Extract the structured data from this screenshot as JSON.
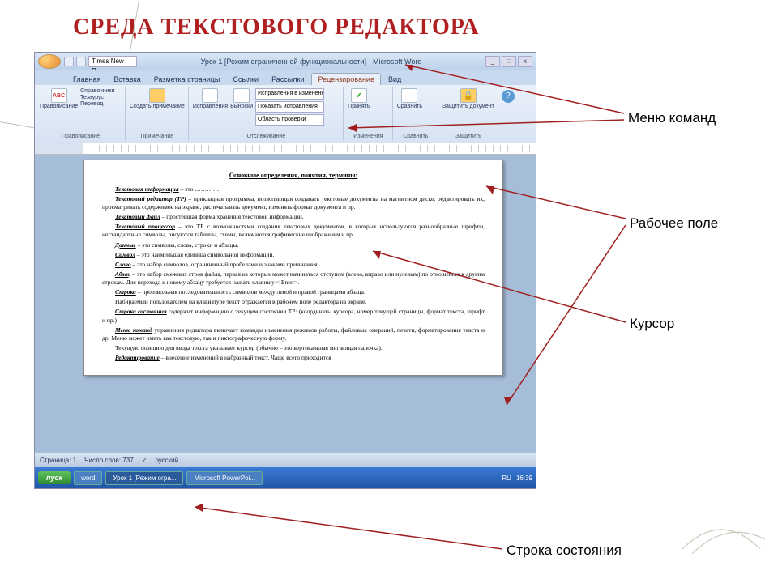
{
  "slide": {
    "title": "СРЕДА ТЕКСТОВОГО РЕДАКТОРА"
  },
  "callouts": {
    "menu": "Меню команд",
    "workspace": "Рабочее поле",
    "cursor": "Курсор",
    "statusbar": "Строка состояния"
  },
  "word": {
    "title_bar": "Урок 1 [Режим ограниченной функциональности] - Microsoft Word",
    "font_box": "Times New R…",
    "tabs": [
      "Главная",
      "Вставка",
      "Разметка страницы",
      "Ссылки",
      "Рассылки",
      "Рецензирование",
      "Вид"
    ],
    "active_tab_index": 5,
    "ribbon": {
      "g1_label": "Правописание",
      "g1_btn1": "Правописание",
      "g1_btn2": "Справочники",
      "g1_btn3": "Тезаурус",
      "g1_btn4": "Перевод",
      "g2_label": "Примечание",
      "g2_btn": "Создать примечание",
      "g3_label": "Отслеживание",
      "g3_btn1": "Исправления",
      "g3_btn2": "Выноски",
      "g3_drop1": "Исправления в измененном документе",
      "g3_drop2": "Показать исправления",
      "g3_drop3": "Область проверки",
      "g4_label": "Изменения",
      "g4_btn": "Принять",
      "g5_label": "Сравнить",
      "g5_btn": "Сравнить",
      "g6_label": "Защитить",
      "g6_btn": "Защитить документ"
    },
    "doc": {
      "heading": "Основные определения, понятия, термины:",
      "p1_term": "Текстовая информация",
      "p1_rest": " – это …………",
      "p2_term": "Текстовый редактор (ТР)",
      "p2_rest": " – прикладная программа, позволяющая создавать текстовые документы на магнитном диске, редактировать их, просматривать содержимое на экране, распечатывать документ, изменять формат документа и пр.",
      "p3_term": "Текстовый файл",
      "p3_rest": " – простейшая форма хранения текстовой информации.",
      "p4_term": "Текстовый процессор",
      "p4_rest": " – это ТР с возможностями создания текстовых документов, в которых используются разнообразные шрифты, нестандартные символы, рисуются таблицы, схемы, включаются графические изображения и пр.",
      "p5_term": "Данные",
      "p5_rest": " – это символы, слова, строки и абзацы.",
      "p6_term": "Символ",
      "p6_rest": " – это наименьшая единица символьной информации.",
      "p7_term": "Слово",
      "p7_rest": " – это набор символов, ограниченный пробелами и знаками препинания.",
      "p8_term": "Абзац",
      "p8_rest": " – это набор смежных строк файла, первая из которых может начинаться отступом (влево, вправо или нулевым) по отношению к другим строкам. Для перехода к новому абзацу требуется нажать клавишу < Enter>.",
      "p9_term": "Строка",
      "p9_rest": " – произвольная последовательность символов между левой и правой границами абзаца.",
      "p10": "Набираемый пользователем на клавиатуре текст отражается в рабочем поле редактора на экране.",
      "p11_term": "Строка состояния",
      "p11_rest": " содержит информацию о текущем состоянии ТР: (координаты курсора, номер текущей страницы, формат текста, шрифт и пр.)",
      "p12_term": "Меню команд",
      "p12_rest": " управления редактора включает команды изменения режимов работы, файловых операций, печати, форматирования текста и др. Меню может иметь как текстовую, так и пиктографическую форму.",
      "p13": "Текущую позицию для ввода текста указывает курсор (обычно – это вертикальная мигающая палочка).",
      "p14_term": "Редактирование",
      "p14_rest": " – внесение изменений в набранный текст. Чаще всего приходится"
    },
    "status": {
      "page": "Страница: 1",
      "words": "Число слов: 737",
      "lang_icon": "✓",
      "lang": "русский"
    },
    "taskbar": {
      "start": "пуск",
      "task1": "word",
      "task2": "Урок 1 [Режим огра...",
      "task3": "Microsoft PowerPoi...",
      "lang": "RU",
      "time": "16:39"
    }
  }
}
